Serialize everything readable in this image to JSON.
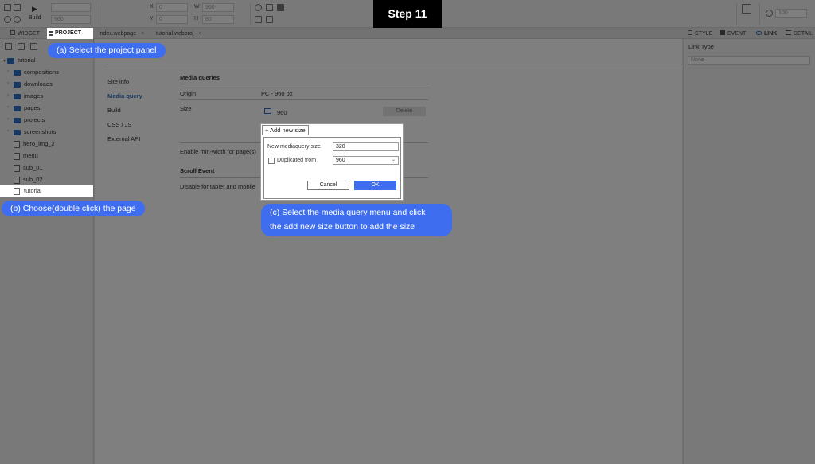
{
  "step_badge": "Step 11",
  "toolbar": {
    "build_label": "Build",
    "width_value": "960",
    "x_label": "X",
    "x_value": "0",
    "y_label": "Y",
    "y_value": "0",
    "w_label": "W",
    "w_value": "960",
    "h_label": "H",
    "h_value": "80",
    "zoom_value": "100"
  },
  "left_tabs": {
    "widget": "WIDGET",
    "project": "PROJECT"
  },
  "doc_tabs": [
    {
      "label": "index.webpage",
      "close": "×"
    },
    {
      "label": "tutorial.webproj",
      "close": "×"
    }
  ],
  "right_tabs": {
    "style": "STYLE",
    "event": "EVENT",
    "link": "LINK",
    "detail": "DETAIL"
  },
  "right_panel": {
    "link_type_label": "Link Type",
    "link_type_value": "None"
  },
  "project_tree": {
    "root": "tutorial",
    "folders": [
      "compositions",
      "downloads",
      "images",
      "pages",
      "projects",
      "screenshots"
    ],
    "files": [
      "hero_img_2",
      "menu",
      "sub_01",
      "sub_02"
    ],
    "selected": "tutorial"
  },
  "settings_nav": [
    "Site info",
    "Media query",
    "Build",
    "CSS / JS",
    "External API"
  ],
  "media_queries": {
    "title": "Media queries",
    "origin_label": "Origin",
    "origin_value": "PC - 960 px",
    "size_label": "Size",
    "size_value": "960",
    "delete_label": "Delete",
    "minwidth_label": "Enable min-width for page(s)",
    "scroll_title": "Scroll Event",
    "scroll_label": "Disable for tablet and mobile"
  },
  "dialog": {
    "title": "+ Add new size",
    "size_label": "New mediaquery size",
    "size_value": "320",
    "dup_label": "Duplicated from",
    "dup_value": "960",
    "cancel_label": "Cancel",
    "ok_label": "OK"
  },
  "callouts": {
    "a": "(a) Select the project panel",
    "b": "(b) Choose(double click) the page",
    "c_line1": "(c) Select the media query menu and click",
    "c_line2": "the add new size button to add the size"
  },
  "colors": {
    "accent": "#3f6df0",
    "folder": "#2d6fc4",
    "badge_bg": "#000000"
  }
}
